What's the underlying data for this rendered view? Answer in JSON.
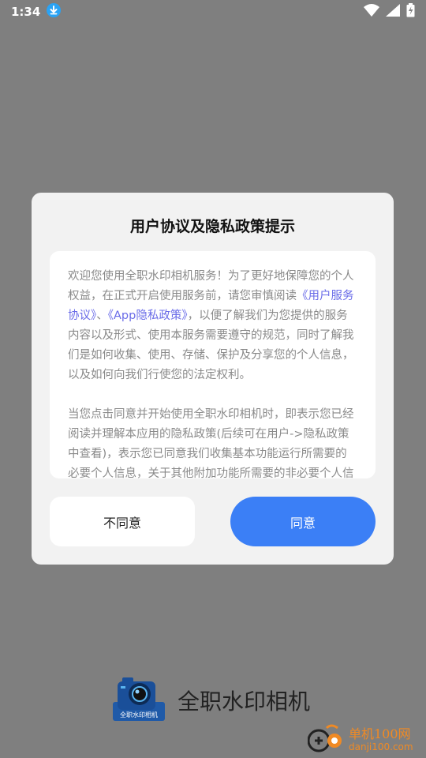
{
  "status_bar": {
    "time": "1:34"
  },
  "dialog": {
    "title": "用户协议及隐私政策提示",
    "para1": {
      "text_before": "欢迎您使用全职水印相机服务！为了更好地保障您的个人权益，在正式开启使用服务前，请您审慎阅读",
      "link_user_agreement": "《用户服务协议》",
      "separator": "、",
      "link_privacy_policy": "《App隐私政策》",
      "text_after": "，以便了解我们为您提供的服务内容以及形式、使用本服务需要遵守的规范，同时了解我们是如何收集、使用、存储、保护及分享您的个人信息，以及如何向我们行使您的法定权利。"
    },
    "para2": "当您点击同意并开始使用全职水印相机时，即表示您已经阅读并理解本应用的隐私政策(后续可在用户->隐私政策中查看)，表示您已同意我们收集基本功能运行所需要的必要个人信息，关于其他附加功能所需要的非必要个人信息，我们将在您使用相关功能时单独征求您的同意。",
    "disagree_label": "不同意",
    "agree_label": "同意"
  },
  "app": {
    "name": "全职水印相机",
    "logo_text": "全职水印相机",
    "logo_icon": "camera-icon"
  },
  "watermark": {
    "site_name": "单机100网",
    "site_url": "danji100.com"
  },
  "colors": {
    "overlay": "#7f7f7f",
    "accent": "#3b7ff6",
    "link": "#6a6ce8",
    "watermark": "#f08a24"
  }
}
